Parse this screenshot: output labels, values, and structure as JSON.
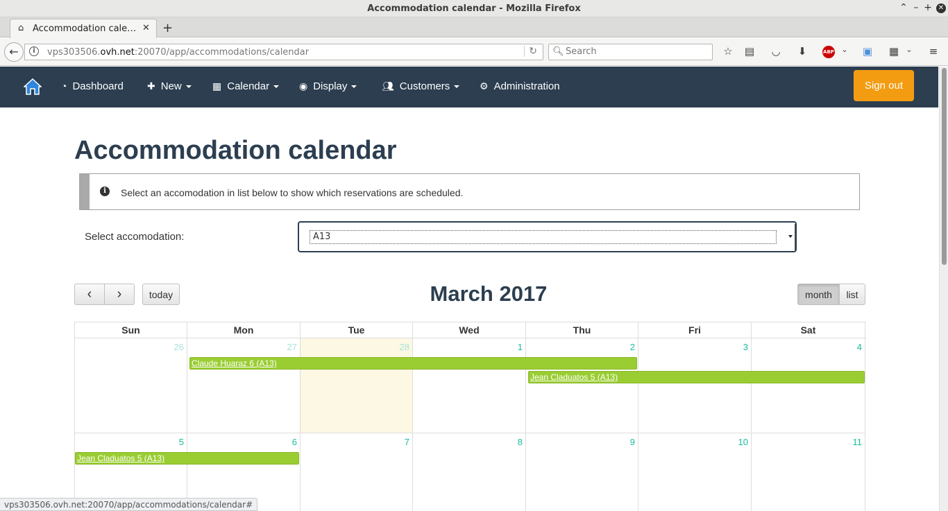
{
  "browser": {
    "window_title": "Accommodation calendar - Mozilla Firefox",
    "tab_title": "Accommodation cale…",
    "url_prefix": "vps303506.",
    "url_domain": "ovh.net",
    "url_rest": ":20070/app/accommodations/calendar",
    "search_placeholder": "Search",
    "abp_label": "ABP",
    "status_url": "vps303506.ovh.net:20070/app/accommodations/calendar#"
  },
  "nav": {
    "dashboard": "Dashboard",
    "new": "New",
    "calendar": "Calendar",
    "display": "Display",
    "customers": "Customers",
    "administration": "Administration",
    "sign_out": "Sign out"
  },
  "page": {
    "title": "Accommodation calendar",
    "info": "Select an accomodation in list below to show which reservations are scheduled.",
    "select_label": "Select accomodation:",
    "select_value": "A13"
  },
  "calendar": {
    "title": "March 2017",
    "prev_icon": "‹",
    "next_icon": "›",
    "today_label": "today",
    "month_label": "month",
    "list_label": "list",
    "weekdays": [
      "Sun",
      "Mon",
      "Tue",
      "Wed",
      "Thu",
      "Fri",
      "Sat"
    ],
    "weeks": [
      [
        "26",
        "27",
        "28",
        "1",
        "2",
        "3",
        "4"
      ],
      [
        "5",
        "6",
        "7",
        "8",
        "9",
        "10",
        "11"
      ]
    ],
    "events": [
      "Claude Huaraz 6 (A13)",
      "Jean Claduatos 5 (A13)",
      "Jean Claduatos 5 (A13)"
    ],
    "colors": {
      "event": "#9acd32",
      "today": "#fcf8e3",
      "day_number": "#18bc9c"
    }
  }
}
